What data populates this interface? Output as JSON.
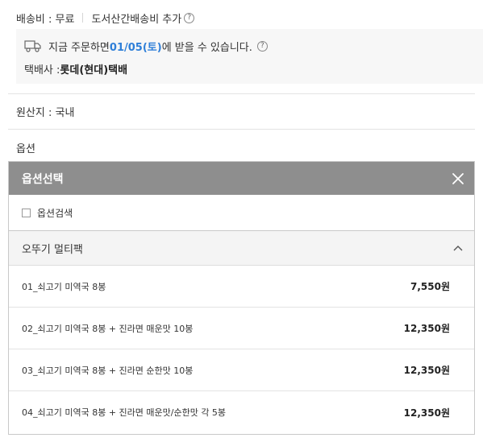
{
  "shipping": {
    "fee_label": "배송비 : 무료",
    "extra_label": "도서산간배송비 추가",
    "help_glyph": "?"
  },
  "delivery": {
    "prefix": "지금 주문하면 ",
    "date": "01/05(토)",
    "suffix": "에 받을 수 있습니다.",
    "help_glyph": "?",
    "carrier_label": "택배사 : ",
    "carrier_name": "롯데(현대)택배"
  },
  "origin": {
    "label": "원산지 : 국내"
  },
  "options": {
    "label": "옵션",
    "panel_title": "옵션선택",
    "search_label": "옵션검색",
    "group_title": "오뚜기 멀티팩",
    "items": [
      {
        "name": "01_쇠고기 미역국 8봉",
        "price": "7,550원"
      },
      {
        "name": "02_쇠고기 미역국 8봉 + 진라면 매운맛 10봉",
        "price": "12,350원"
      },
      {
        "name": "03_쇠고기 미역국 8봉 + 진라면 순한맛 10봉",
        "price": "12,350원"
      },
      {
        "name": "04_쇠고기 미역국 8봉 + 진라면 매운맛/순한맛 각 5봉",
        "price": "12,350원"
      }
    ]
  },
  "colors": {
    "panel_header_bg": "#8e8e8e",
    "date_highlight": "#2f7fd8",
    "delivery_box_bg": "#f7f7f7"
  },
  "icons": [
    "truck-icon",
    "help-icon",
    "close-icon",
    "chevron-up-icon",
    "checkbox"
  ]
}
